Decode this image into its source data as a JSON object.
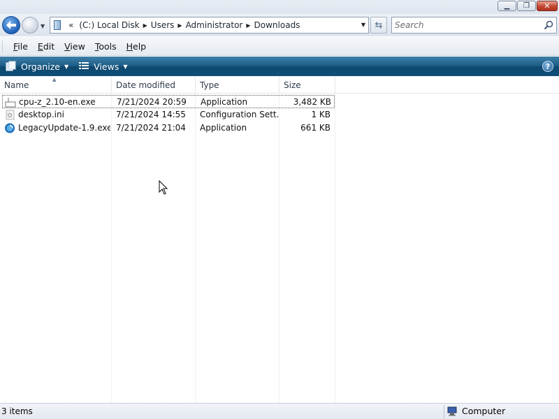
{
  "window": {
    "controls": {
      "minimize_icon": "minimize-icon",
      "maximize_icon": "maximize-icon",
      "close_icon": "close-icon"
    }
  },
  "address": {
    "overflow": "«",
    "crumbs": [
      "(C:) Local Disk",
      "Users",
      "Administrator",
      "Downloads"
    ]
  },
  "search": {
    "placeholder": "Search"
  },
  "menu": {
    "items": [
      {
        "accel": "F",
        "rest": "ile"
      },
      {
        "accel": "E",
        "rest": "dit"
      },
      {
        "accel": "V",
        "rest": "iew"
      },
      {
        "accel": "T",
        "rest": "ools"
      },
      {
        "accel": "H",
        "rest": "elp"
      }
    ]
  },
  "toolbar": {
    "organize": "Organize",
    "views": "Views"
  },
  "columns": {
    "name": "Name",
    "date": "Date modified",
    "type": "Type",
    "size": "Size"
  },
  "files": [
    {
      "name": "cpu-z_2.10-en.exe",
      "date": "7/21/2024 20:59",
      "type": "Application",
      "size": "3,482 KB",
      "icon": "application-icon"
    },
    {
      "name": "desktop.ini",
      "date": "7/21/2024 14:55",
      "type": "Configuration Sett...",
      "size": "1 KB",
      "icon": "config-file-icon"
    },
    {
      "name": "LegacyUpdate-1.9.exe",
      "date": "7/21/2024 21:04",
      "type": "Application",
      "size": "661 KB",
      "icon": "legacy-update-icon"
    }
  ],
  "status": {
    "count": "3 items",
    "zone": "Computer"
  },
  "colors": {
    "toolbar": "#1f5f89",
    "accent": "#1d5fb6"
  }
}
